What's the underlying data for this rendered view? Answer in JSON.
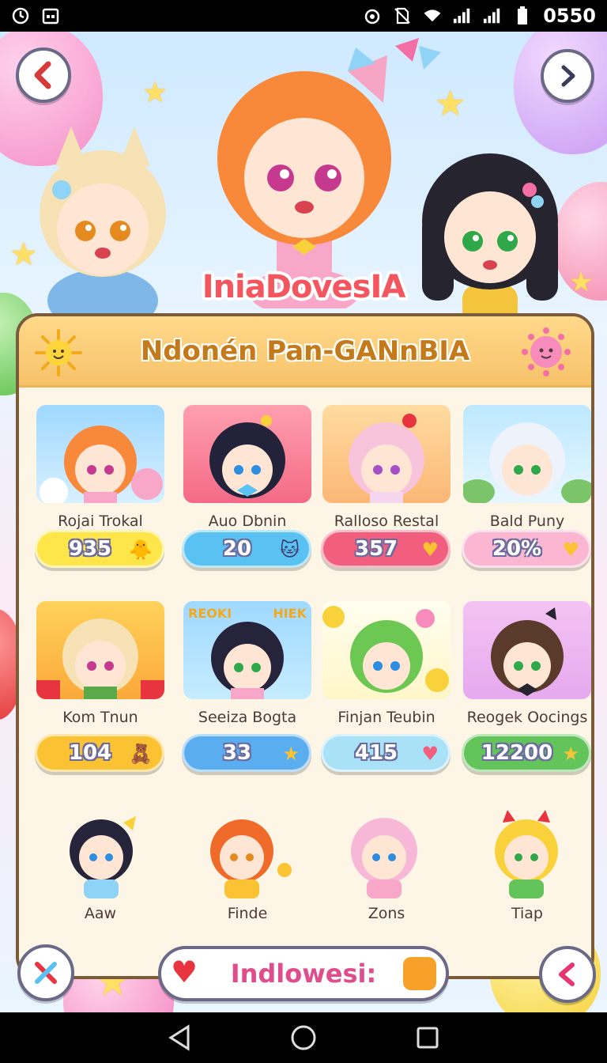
{
  "status_bar": {
    "time": "0550"
  },
  "hero": {
    "title": "IniaDovesIA"
  },
  "panel": {
    "title": "Ndonén Pan-GANnBIA",
    "cards": [
      {
        "name": "Rojai Trokal",
        "value": "935",
        "pill_color": "#fde54a",
        "icon": "chick-icon"
      },
      {
        "name": "Auo Dbnin",
        "value": "20",
        "pill_color": "#5ac2f2",
        "icon": "cat-face-icon"
      },
      {
        "name": "Ralloso Restal",
        "value": "357",
        "pill_color": "#f25e7e",
        "icon": "heart-icon"
      },
      {
        "name": "Bald Puny",
        "value": "20%",
        "pill_color": "#fbb6d2",
        "icon": "heart-icon"
      },
      {
        "name": "Kom Tnun",
        "value": "104",
        "pill_color": "#fbc334",
        "icon": "character-icon"
      },
      {
        "name": "Seeiza Bogta",
        "value": "33",
        "pill_color": "#5aaef0",
        "icon": "star-icon"
      },
      {
        "name": "Finjan Teubin",
        "value": "415",
        "pill_color": "#a9e2f7",
        "icon": "heart-icon"
      },
      {
        "name": "Reogek Oocings",
        "value": "12200",
        "pill_color": "#62c45a",
        "icon": "star-icon"
      }
    ],
    "free_characters": [
      {
        "name": "Aaw"
      },
      {
        "name": "Finde"
      },
      {
        "name": "Zons"
      },
      {
        "name": "Tiap"
      }
    ],
    "thumb_texts": {
      "card6_left": "REOKI",
      "card6_right": "HIEK"
    }
  },
  "bottom_bar": {
    "label": "Indlowesi:"
  },
  "colors": {
    "accent": "#f4565f",
    "panel_border": "#7a5b3a",
    "panel_bg": "#fdf6e6",
    "header": "#f7c26a"
  }
}
